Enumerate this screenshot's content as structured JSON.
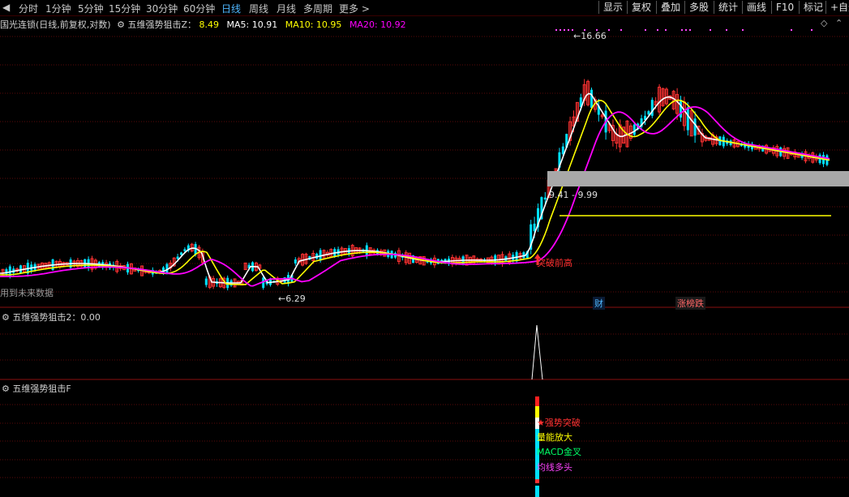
{
  "toolbar": {
    "nav_left": "◀",
    "timeframes": [
      {
        "label": "分时"
      },
      {
        "label": "1分钟"
      },
      {
        "label": "5分钟"
      },
      {
        "label": "15分钟"
      },
      {
        "label": "30分钟"
      },
      {
        "label": "60分钟"
      },
      {
        "label": "日线",
        "active": true
      },
      {
        "label": "周线"
      },
      {
        "label": "月线"
      },
      {
        "label": "多周期"
      },
      {
        "label": "更多 >"
      }
    ],
    "buttons": [
      "显示",
      "复权",
      "叠加",
      "多股",
      "统计",
      "画线",
      "F10",
      "标记",
      "+自选"
    ]
  },
  "main_chart": {
    "title": "国光连锁(日线,前复权,对数)",
    "indicator_name": "五维强势狙击Z：",
    "indicator_value": "8.49",
    "ma5_label": "MA5: 10.91",
    "ma10_label": "MA10: 10.95",
    "ma20_label": "MA20: 10.92",
    "future_data_note": "用到未来数据",
    "high_label": "16.66",
    "low_label": "6.29",
    "range_low": "9.41",
    "range_high": "9.99",
    "breakout_label": "突破前高",
    "marker_finance": "财",
    "marker_limit": "涨榜跌",
    "colors": {
      "up": "#ff3232",
      "down": "#00e0ff",
      "ma5": "#ffffff",
      "ma10": "#ffff00",
      "ma20": "#ff00ff",
      "grid": "#5a0a0a"
    }
  },
  "panel2": {
    "title": "五维强势狙击2：",
    "value": "0.00"
  },
  "panel3": {
    "title": "五维强势狙击F",
    "signals": [
      "强势突破",
      "量能放大",
      "MACD金叉",
      "均线多头"
    ],
    "signal_colors": [
      "#ff3232",
      "#ffff00",
      "#00ff66",
      "#ff44ff"
    ]
  }
}
